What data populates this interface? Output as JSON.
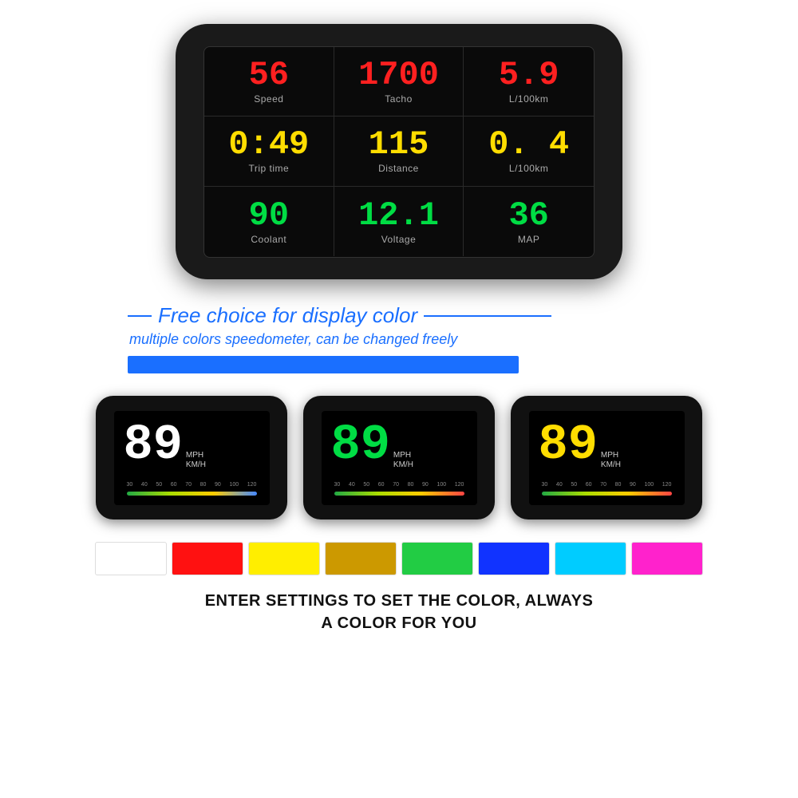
{
  "hud": {
    "device_bg": "#1a1a1a",
    "cells": [
      {
        "value": "56",
        "label": "Speed",
        "color": "red",
        "id": "speed"
      },
      {
        "value": "1700",
        "label": "Tacho",
        "color": "red",
        "id": "tacho"
      },
      {
        "value": "5.9",
        "label": "L/100km",
        "color": "red",
        "id": "fuel1"
      },
      {
        "value": "0:49",
        "label": "Trip time",
        "color": "yellow",
        "id": "trip"
      },
      {
        "value": "115",
        "label": "Distance",
        "color": "yellow",
        "id": "distance"
      },
      {
        "value": "0. 4",
        "label": "L/100km",
        "color": "yellow",
        "id": "fuel2"
      },
      {
        "value": "90",
        "label": "Coolant",
        "color": "green",
        "id": "coolant"
      },
      {
        "value": "12.1",
        "label": "Voltage",
        "color": "green",
        "id": "voltage"
      },
      {
        "value": "36",
        "label": "MAP",
        "color": "green",
        "id": "map"
      }
    ]
  },
  "free_choice": {
    "title": "Free choice for display color",
    "subtitle": "multiple colors speedometer, can be changed freely"
  },
  "mini_devices": [
    {
      "speed": "89",
      "color": "#ffffff",
      "arc_color": "#4488ff",
      "id": "white-display"
    },
    {
      "speed": "89",
      "color": "#00dd44",
      "arc_color": "#ff4444",
      "id": "green-display"
    },
    {
      "speed": "89",
      "color": "#ffdd00",
      "arc_color": "#ff4444",
      "id": "yellow-display"
    }
  ],
  "units_label": "MPH\nKM/H",
  "arc_labels": [
    "30",
    "40",
    "50",
    "60",
    "70",
    "80",
    "90",
    "100",
    "120"
  ],
  "swatches": [
    {
      "color": "#ffffff",
      "id": "white-swatch"
    },
    {
      "color": "#ff1111",
      "id": "red-swatch"
    },
    {
      "color": "#ffee00",
      "id": "yellow-swatch"
    },
    {
      "color": "#cc9900",
      "id": "gold-swatch"
    },
    {
      "color": "#22cc44",
      "id": "green-swatch"
    },
    {
      "color": "#1133ff",
      "id": "blue-swatch"
    },
    {
      "color": "#00ccff",
      "id": "cyan-swatch"
    },
    {
      "color": "#ff22cc",
      "id": "magenta-swatch"
    }
  ],
  "bottom_text_line1": "ENTER SETTINGS TO SET THE COLOR, ALWAYS",
  "bottom_text_line2": "A COLOR FOR YOU"
}
